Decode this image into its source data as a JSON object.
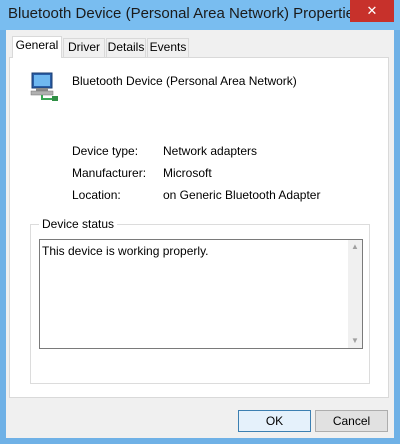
{
  "window": {
    "title": "Bluetooth Device (Personal Area Network) Properties",
    "close_glyph": "✕"
  },
  "tabs": [
    {
      "label": "General",
      "active": true
    },
    {
      "label": "Driver",
      "active": false
    },
    {
      "label": "Details",
      "active": false
    },
    {
      "label": "Events",
      "active": false
    }
  ],
  "general": {
    "device_icon": "network-adapter-icon",
    "device_name": "Bluetooth Device (Personal Area Network)",
    "properties": [
      {
        "label": "Device type:",
        "value": "Network adapters"
      },
      {
        "label": "Manufacturer:",
        "value": "Microsoft"
      },
      {
        "label": "Location:",
        "value": "on Generic Bluetooth Adapter"
      }
    ],
    "status_group_label": "Device status",
    "status_text": "This device is working properly."
  },
  "buttons": {
    "ok_label": "OK",
    "cancel_label": "Cancel"
  },
  "colors": {
    "titlebar": "#79bdf0",
    "close_button": "#c7312b"
  }
}
